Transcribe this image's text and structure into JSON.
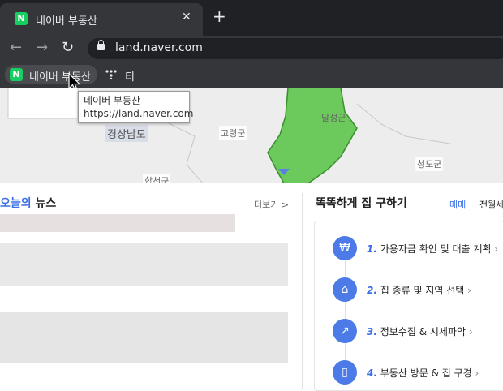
{
  "browser": {
    "tab_title": "네이버 부동산",
    "tab_favicon": "N",
    "new_tab": "+",
    "close": "✕",
    "url": "land.naver.com",
    "bookmarks": [
      {
        "label": "네이버 부동산",
        "icon": "naver-favicon-icon"
      },
      {
        "label": "티",
        "icon": "tmap-icon"
      }
    ]
  },
  "tooltip": {
    "title": "네이버 부동산",
    "url": "https://land.naver.com"
  },
  "map": {
    "labels": [
      "경상남도",
      "고령군",
      "달성군",
      "청도군",
      "합천군"
    ],
    "region_color": "#6cc95c"
  },
  "news": {
    "title_highlight": "오늘의",
    "title_rest": " 뉴스",
    "more": "더보기 >"
  },
  "guide": {
    "title": "똑똑하게 집 구하기",
    "tabs": [
      "매매",
      "전월세"
    ],
    "steps": [
      {
        "num": "1.",
        "text": "가용자금 확인 및 대출 계획",
        "icon": "won-icon",
        "glyph": "₩"
      },
      {
        "num": "2.",
        "text": "집 종류 및 지역 선택",
        "icon": "house-icon",
        "glyph": "⌂"
      },
      {
        "num": "3.",
        "text": "정보수집 & 시세파악",
        "icon": "chart-icon",
        "glyph": "↗"
      },
      {
        "num": "4.",
        "text": "부동산 방문 & 집 구경",
        "icon": "door-icon",
        "glyph": "▯"
      }
    ]
  },
  "colors": {
    "accent": "#3b6fe6",
    "chrome_dark": "#202124",
    "chrome_mid": "#35363a"
  }
}
